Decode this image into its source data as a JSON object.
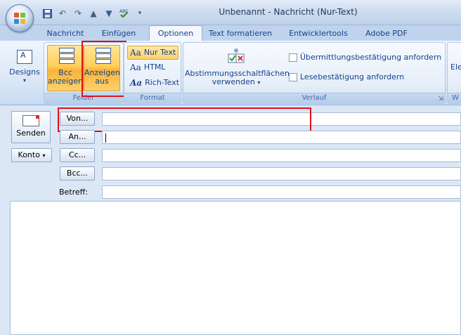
{
  "window": {
    "title": "Unbenannt - Nachricht (Nur-Text)"
  },
  "qat": {
    "save_icon": "save-icon",
    "undo_icon": "undo-icon",
    "redo_icon": "redo-icon",
    "up_icon": "arrow-up-icon",
    "down_icon": "arrow-down-icon",
    "spell_icon": "spellcheck-icon",
    "menu_icon": "qat-dropdown-icon"
  },
  "tabs": [
    {
      "label": "Nachricht"
    },
    {
      "label": "Einfügen"
    },
    {
      "label": "Optionen",
      "active": true
    },
    {
      "label": "Text formatieren"
    },
    {
      "label": "Entwicklertools"
    },
    {
      "label": "Adobe PDF"
    }
  ],
  "ribbon": {
    "designs": {
      "label": "Designs"
    },
    "felder": {
      "label": "Felder",
      "bcc_line1": "Bcc",
      "bcc_line2": "anzeigen",
      "from_line1": "Anzeigen",
      "from_line2": "aus"
    },
    "format": {
      "label": "Format",
      "options": [
        "Nur Text",
        "HTML",
        "Rich-Text"
      ],
      "active": "Nur Text"
    },
    "verlauf": {
      "label": "Verlauf",
      "voting_line1": "Abstimmungsschaltflächen",
      "voting_line2": "verwenden",
      "checkbox1": "Übermittlungsbestätigung anfordern",
      "checkbox2": "Lesebestätigung anfordern"
    },
    "extra": {
      "line1": "Ele",
      "label": "W"
    }
  },
  "compose": {
    "send_label": "Senden",
    "account_label": "Konto",
    "von_label": "Von...",
    "an_label": "An...",
    "cc_label": "Cc...",
    "bcc_label": "Bcc...",
    "subject_label": "Betreff:",
    "von_value": "",
    "an_value": "",
    "cc_value": "",
    "bcc_value": "",
    "subject_value": "",
    "body_value": ""
  },
  "colors": {
    "highlight": "#e0101b",
    "accent": "#15428b"
  }
}
